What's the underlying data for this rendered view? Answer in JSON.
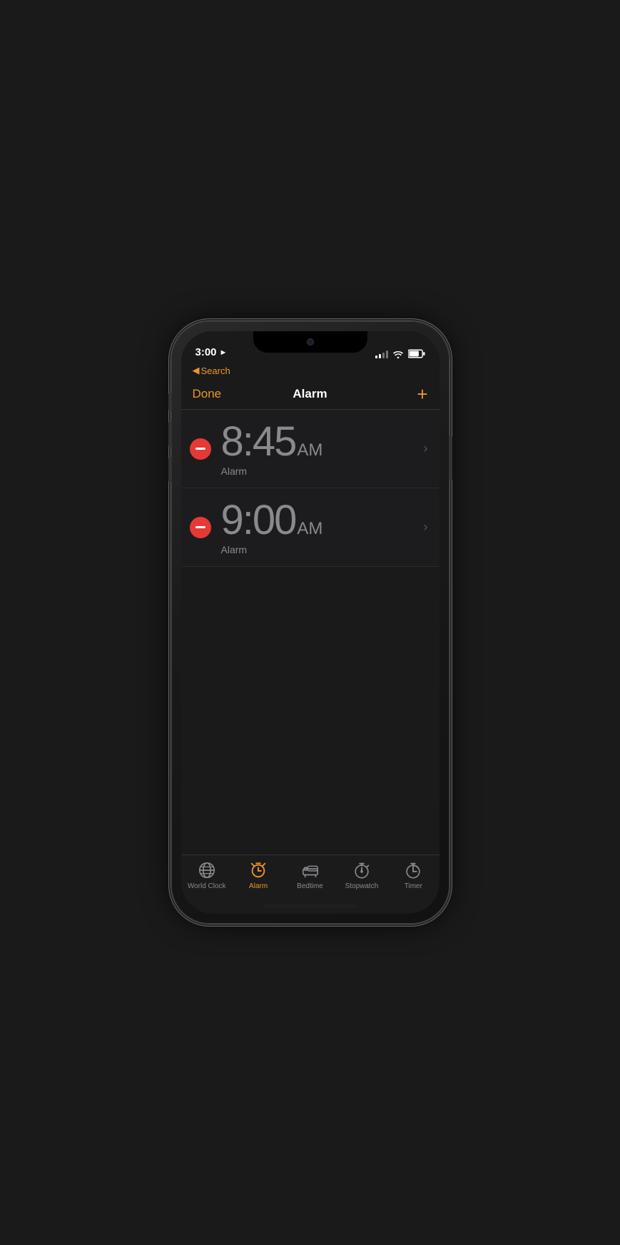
{
  "status": {
    "time": "3:00",
    "location_icon": "►",
    "back_label": "Search"
  },
  "nav": {
    "done_label": "Done",
    "title": "Alarm",
    "add_label": "+"
  },
  "alarms": [
    {
      "time": "8:45",
      "ampm": "AM",
      "label": "Alarm"
    },
    {
      "time": "9:00",
      "ampm": "AM",
      "label": "Alarm"
    }
  ],
  "tabs": [
    {
      "id": "world-clock",
      "label": "World Clock",
      "active": false
    },
    {
      "id": "alarm",
      "label": "Alarm",
      "active": true
    },
    {
      "id": "bedtime",
      "label": "Bedtime",
      "active": false
    },
    {
      "id": "stopwatch",
      "label": "Stopwatch",
      "active": false
    },
    {
      "id": "timer",
      "label": "Timer",
      "active": false
    }
  ]
}
